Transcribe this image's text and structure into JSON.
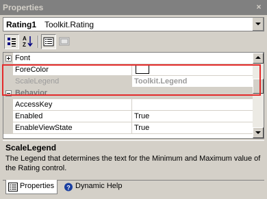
{
  "window": {
    "title": "Properties",
    "close_glyph": "×"
  },
  "selector": {
    "object_name": "Rating1",
    "object_type": "Toolkit.Rating"
  },
  "toolbar": {
    "buttons": [
      {
        "name": "categorized",
        "icon": "categorized-icon",
        "pressed": true
      },
      {
        "name": "alphabetical",
        "icon": "alphabetical-icon",
        "pressed": false
      },
      {
        "name": "properties",
        "icon": "properties-icon",
        "pressed": true
      },
      {
        "name": "property-pages",
        "icon": "property-pages-icon",
        "pressed": false
      }
    ]
  },
  "grid": {
    "rows": [
      {
        "type": "category",
        "name": "Font",
        "expanded": false
      },
      {
        "type": "property",
        "name": "ForeColor",
        "value": ""
      },
      {
        "type": "property",
        "name": "ScaleLegend",
        "value": "Toolkit.Legend",
        "selected": true
      },
      {
        "type": "category",
        "name": "Behavior",
        "expanded": true
      },
      {
        "type": "property",
        "name": "AccessKey",
        "value": ""
      },
      {
        "type": "property",
        "name": "Enabled",
        "value": "True"
      },
      {
        "type": "property",
        "name": "EnableViewState",
        "value": "True"
      }
    ]
  },
  "description": {
    "title": "ScaleLegend",
    "text": "The Legend that determines the text for the Minimum and Maximum value of the Rating control."
  },
  "tabs": [
    {
      "label": "Properties",
      "icon": "properties-tab-icon",
      "active": true
    },
    {
      "label": "Dynamic Help",
      "icon": "help-icon",
      "active": false
    }
  ],
  "colors": {
    "highlight": "#e32a2a",
    "panel": "#d4d0c8",
    "titlebar": "#808080"
  }
}
